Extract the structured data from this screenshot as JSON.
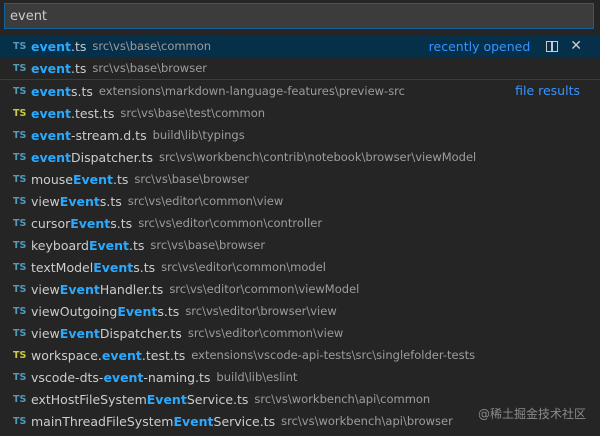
{
  "search": {
    "value": "event"
  },
  "recently_opened_label": "recently opened",
  "file_results_label": "file results",
  "watermark": "@稀土掘金技术社区",
  "colors": {
    "highlight": "#2aaaff",
    "focused_row": "#062f4a",
    "ts_icon": "#519aba",
    "ts_test_icon": "#cbcb41",
    "link": "#3794ff"
  },
  "results": [
    {
      "icon": "TS",
      "icon_color": "blue",
      "parts": [
        {
          "t": "event",
          "h": true
        },
        {
          "t": ".ts",
          "h": false
        }
      ],
      "desc": "src\\vs\\base\\common",
      "focused": true,
      "section": "recent"
    },
    {
      "icon": "TS",
      "icon_color": "blue",
      "parts": [
        {
          "t": "event",
          "h": true
        },
        {
          "t": ".ts",
          "h": false
        }
      ],
      "desc": "src\\vs\\base\\browser",
      "section": "recent"
    },
    {
      "icon": "TS",
      "icon_color": "blue",
      "parts": [
        {
          "t": "event",
          "h": true
        },
        {
          "t": "s.ts",
          "h": false
        }
      ],
      "desc": "extensions\\markdown-language-features\\preview-src",
      "section": "file",
      "first_of_section": true
    },
    {
      "icon": "TS",
      "icon_color": "yellow",
      "parts": [
        {
          "t": "event",
          "h": true
        },
        {
          "t": ".test.ts",
          "h": false
        }
      ],
      "desc": "src\\vs\\base\\test\\common",
      "section": "file"
    },
    {
      "icon": "TS",
      "icon_color": "blue",
      "parts": [
        {
          "t": "event",
          "h": true
        },
        {
          "t": "-stream.d.ts",
          "h": false
        }
      ],
      "desc": "build\\lib\\typings",
      "section": "file"
    },
    {
      "icon": "TS",
      "icon_color": "blue",
      "parts": [
        {
          "t": "event",
          "h": true
        },
        {
          "t": "Dispatcher.ts",
          "h": false
        }
      ],
      "desc": "src\\vs\\workbench\\contrib\\notebook\\browser\\viewModel",
      "section": "file"
    },
    {
      "icon": "TS",
      "icon_color": "blue",
      "parts": [
        {
          "t": "mouse",
          "h": false
        },
        {
          "t": "Event",
          "h": true
        },
        {
          "t": ".ts",
          "h": false
        }
      ],
      "desc": "src\\vs\\base\\browser",
      "section": "file"
    },
    {
      "icon": "TS",
      "icon_color": "blue",
      "parts": [
        {
          "t": "view",
          "h": false
        },
        {
          "t": "Event",
          "h": true
        },
        {
          "t": "s.ts",
          "h": false
        }
      ],
      "desc": "src\\vs\\editor\\common\\view",
      "section": "file"
    },
    {
      "icon": "TS",
      "icon_color": "blue",
      "parts": [
        {
          "t": "cursor",
          "h": false
        },
        {
          "t": "Event",
          "h": true
        },
        {
          "t": "s.ts",
          "h": false
        }
      ],
      "desc": "src\\vs\\editor\\common\\controller",
      "section": "file"
    },
    {
      "icon": "TS",
      "icon_color": "blue",
      "parts": [
        {
          "t": "keyboard",
          "h": false
        },
        {
          "t": "Event",
          "h": true
        },
        {
          "t": ".ts",
          "h": false
        }
      ],
      "desc": "src\\vs\\base\\browser",
      "section": "file"
    },
    {
      "icon": "TS",
      "icon_color": "blue",
      "parts": [
        {
          "t": "textModel",
          "h": false
        },
        {
          "t": "Event",
          "h": true
        },
        {
          "t": "s.ts",
          "h": false
        }
      ],
      "desc": "src\\vs\\editor\\common\\model",
      "section": "file"
    },
    {
      "icon": "TS",
      "icon_color": "blue",
      "parts": [
        {
          "t": "view",
          "h": false
        },
        {
          "t": "Event",
          "h": true
        },
        {
          "t": "Handler.ts",
          "h": false
        }
      ],
      "desc": "src\\vs\\editor\\common\\viewModel",
      "section": "file"
    },
    {
      "icon": "TS",
      "icon_color": "blue",
      "parts": [
        {
          "t": "viewOutgoing",
          "h": false
        },
        {
          "t": "Event",
          "h": true
        },
        {
          "t": "s.ts",
          "h": false
        }
      ],
      "desc": "src\\vs\\editor\\browser\\view",
      "section": "file"
    },
    {
      "icon": "TS",
      "icon_color": "blue",
      "parts": [
        {
          "t": "view",
          "h": false
        },
        {
          "t": "Event",
          "h": true
        },
        {
          "t": "Dispatcher.ts",
          "h": false
        }
      ],
      "desc": "src\\vs\\editor\\common\\view",
      "section": "file"
    },
    {
      "icon": "TS",
      "icon_color": "yellow",
      "parts": [
        {
          "t": "workspace.",
          "h": false
        },
        {
          "t": "event",
          "h": true
        },
        {
          "t": ".test.ts",
          "h": false
        }
      ],
      "desc": "extensions\\vscode-api-tests\\src\\singlefolder-tests",
      "section": "file"
    },
    {
      "icon": "TS",
      "icon_color": "blue",
      "parts": [
        {
          "t": "vscode-dts-",
          "h": false
        },
        {
          "t": "event",
          "h": true
        },
        {
          "t": "-naming.ts",
          "h": false
        }
      ],
      "desc": "build\\lib\\eslint",
      "section": "file"
    },
    {
      "icon": "TS",
      "icon_color": "blue",
      "parts": [
        {
          "t": "extHostFileSystem",
          "h": false
        },
        {
          "t": "Event",
          "h": true
        },
        {
          "t": "Service.ts",
          "h": false
        }
      ],
      "desc": "src\\vs\\workbench\\api\\common",
      "section": "file"
    },
    {
      "icon": "TS",
      "icon_color": "blue",
      "parts": [
        {
          "t": "mainThreadFileSystem",
          "h": false
        },
        {
          "t": "Event",
          "h": true
        },
        {
          "t": "Service.ts",
          "h": false
        }
      ],
      "desc": "src\\vs\\workbench\\api\\browser",
      "section": "file"
    }
  ]
}
